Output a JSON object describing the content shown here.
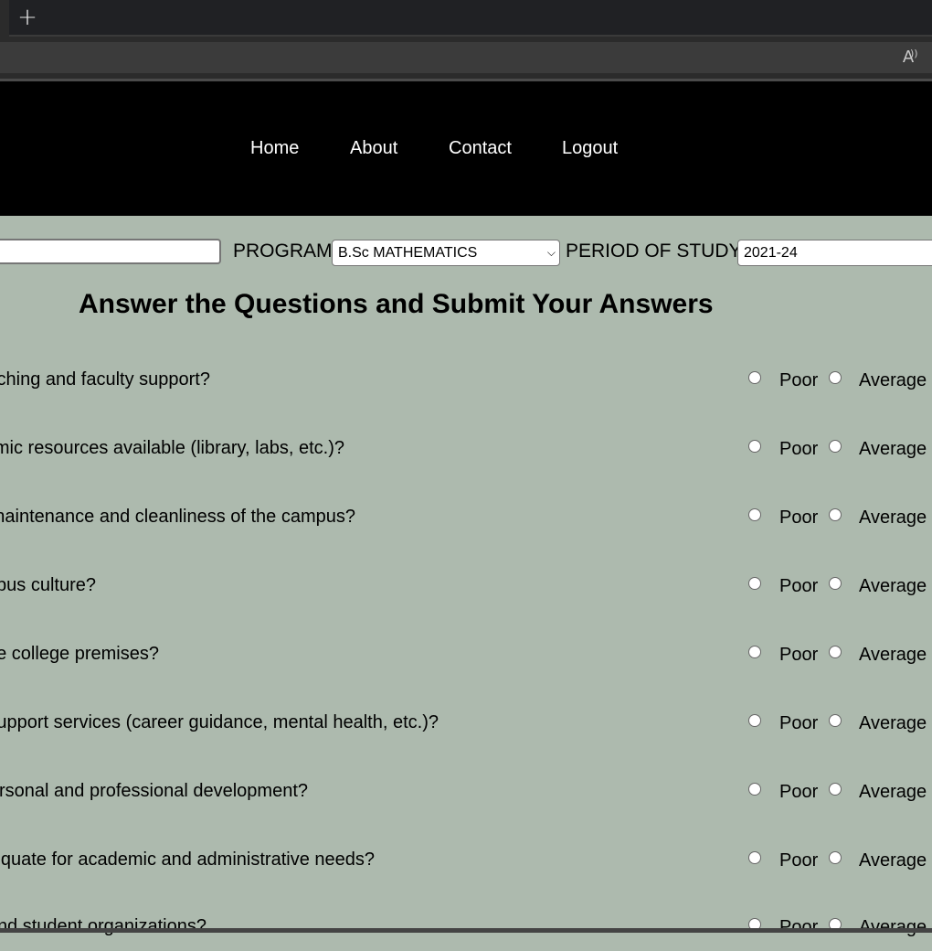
{
  "browser": {
    "new_tab_glyph": "+",
    "read_aloud_icon": "A"
  },
  "nav": {
    "links": [
      "Home",
      "About",
      "Contact",
      "Logout"
    ]
  },
  "form": {
    "name_value": "",
    "program_label": "PROGRAM",
    "program_selected": "B.Sc MATHEMATICS",
    "period_label": "PERIOD OF STUDY",
    "period_value": "2021-24"
  },
  "heading": "Answer the Questions and Submit Your Answers",
  "questions": [
    "ching and faculty support?",
    "mic resources available (library, labs, etc.)?",
    "naintenance and cleanliness of the campus?",
    "pus culture?",
    "e college premises?",
    "upport services (career guidance, mental health, etc.)?",
    "rsonal and professional development?",
    "equate for academic and administrative needs?",
    "nd student organizations?"
  ],
  "options": [
    "Poor",
    "Average"
  ],
  "colors": {
    "page_bg": "#adbaae",
    "navbar_bg": "#000000",
    "nav_text": "#ffffff"
  }
}
